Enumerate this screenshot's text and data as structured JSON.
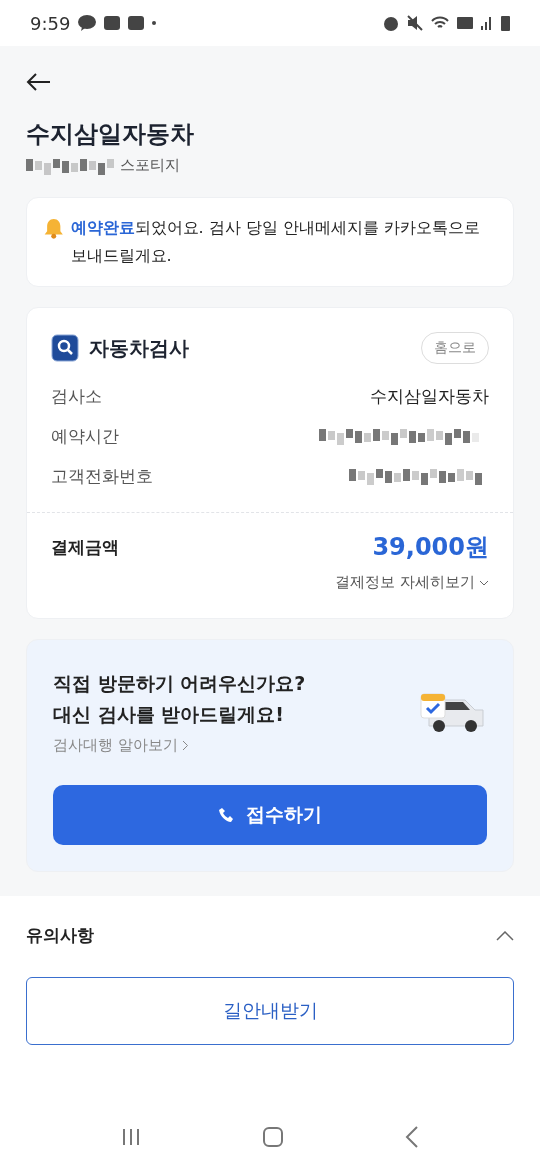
{
  "status_bar": {
    "time": "9:59"
  },
  "header": {
    "title": "수지삼일자동차",
    "subtitle": "스포티지"
  },
  "notice": {
    "text": "**예약완료**되었어요. 검사 당일 안내메세지를 카카오톡으로 보내드릴게요."
  },
  "inspection_card": {
    "title": "자동차검사",
    "home_button": "홈으로",
    "rows": [
      {
        "kind": "text",
        "label": "검사소",
        "value": "수지삼일자동차"
      },
      {
        "kind": "redacted",
        "label": "예약시간"
      },
      {
        "kind": "redacted",
        "label": "고객전화번호"
      }
    ],
    "payment_label": "결제금액",
    "payment_amount": "39,000원",
    "payment_details_link": "결제정보 자세히보기"
  },
  "proxy_card": {
    "headline_1": "직접 방문하기 어려우신가요?",
    "headline_2": "대신 검사를 받아드릴게요!",
    "link": "검사대행 알아보기",
    "button": "접수하기"
  },
  "notes_section": {
    "title": "유의사항",
    "expanded": true
  },
  "bottom_button": "길안내받기"
}
